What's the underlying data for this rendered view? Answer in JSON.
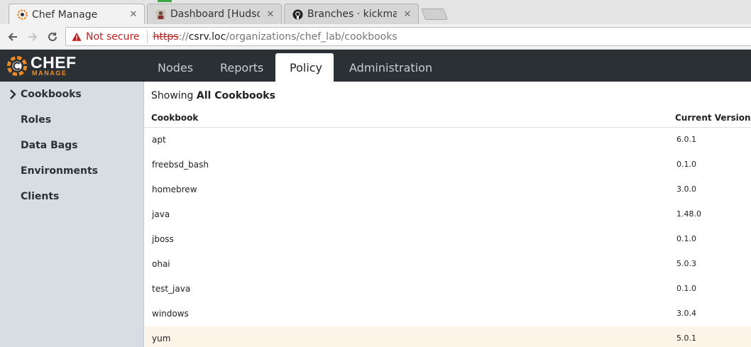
{
  "browser": {
    "tabs": [
      {
        "title": "Chef Manage",
        "favicon": "chef-icon"
      },
      {
        "title": "Dashboard [Hudson",
        "favicon": "hudson-icon"
      },
      {
        "title": "Branches · kickman",
        "favicon": "github-icon"
      }
    ],
    "close_glyph": "✕",
    "security_label": "Not secure",
    "url": {
      "scheme": "https",
      "scheme_sep": "://",
      "host": "csrv.loc",
      "path": "/organizations/chef_lab/cookbooks"
    }
  },
  "app": {
    "logo": {
      "name": "CHEF",
      "sub": "MANAGE"
    },
    "nav": [
      "Nodes",
      "Reports",
      "Policy",
      "Administration"
    ],
    "active_nav": "Policy"
  },
  "sidebar": {
    "items": [
      "Cookbooks",
      "Roles",
      "Data Bags",
      "Environments",
      "Clients"
    ],
    "active": "Cookbooks"
  },
  "main": {
    "showing_prefix": "Showing",
    "showing_value": "All Cookbooks",
    "columns": {
      "name": "Cookbook",
      "version": "Current Version"
    },
    "rows": [
      {
        "name": "apt",
        "version": "6.0.1"
      },
      {
        "name": "freebsd_bash",
        "version": "0.1.0"
      },
      {
        "name": "homebrew",
        "version": "3.0.0"
      },
      {
        "name": "java",
        "version": "1.48.0"
      },
      {
        "name": "jboss",
        "version": "0.1.0"
      },
      {
        "name": "ohai",
        "version": "5.0.3"
      },
      {
        "name": "test_java",
        "version": "0.1.0"
      },
      {
        "name": "windows",
        "version": "3.0.4"
      },
      {
        "name": "yum",
        "version": "5.0.1"
      }
    ],
    "highlighted_row": "yum"
  },
  "colors": {
    "header_bg": "#2b3035",
    "accent_orange": "#f18b21",
    "sidebar_bg": "#d6dde3",
    "row_highlight": "#fdf4e8",
    "not_secure_red": "#c5221f"
  }
}
